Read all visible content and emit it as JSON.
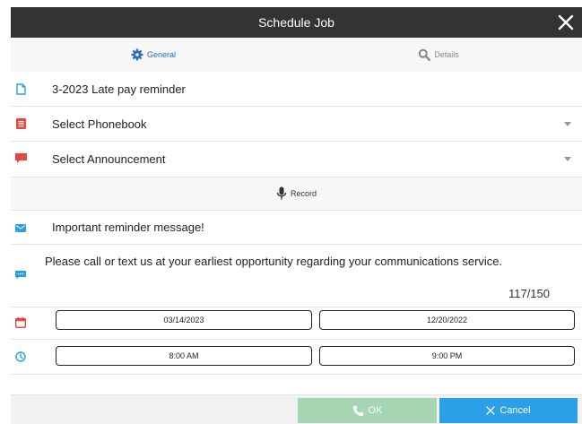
{
  "dialog": {
    "title": "Schedule Job",
    "close_icon": "close-icon"
  },
  "tabs": [
    {
      "label": "General",
      "icon": "gear-icon",
      "active": true
    },
    {
      "label": "Details",
      "icon": "search-icon",
      "active": false
    }
  ],
  "form": {
    "job_name": {
      "value": "3-2023 Late pay reminder",
      "icon": "document-icon",
      "icon_color": "#2b9fe8"
    },
    "phonebook": {
      "value": "Select Phonebook",
      "icon": "list-icon",
      "icon_color": "#e8473c"
    },
    "announcement": {
      "value": "Select Announcement",
      "icon": "chat-icon",
      "icon_color": "#e8473c"
    },
    "record_label": "Record",
    "subject": {
      "value": "Important reminder message!",
      "icon": "envelope-icon",
      "icon_color": "#2b9fe8"
    },
    "message": {
      "value": "Please call or text us at your earliest opportunity regarding your communications service.",
      "counter": "117/150",
      "icon": "comment-icon",
      "icon_color": "#2b9fe8"
    },
    "dates": {
      "start": "03/14/2023",
      "end": "12/20/2022",
      "icon": "calendar-icon",
      "icon_color": "#e8473c"
    },
    "times": {
      "start": "8:00 AM",
      "end": "9:00 PM",
      "icon": "clock-icon",
      "icon_color": "#2b9fe8"
    }
  },
  "footer": {
    "ok_label": "OK",
    "cancel_label": "Cancel",
    "ok_color": "#a6d5b4",
    "cancel_color": "#2b9fe8"
  }
}
